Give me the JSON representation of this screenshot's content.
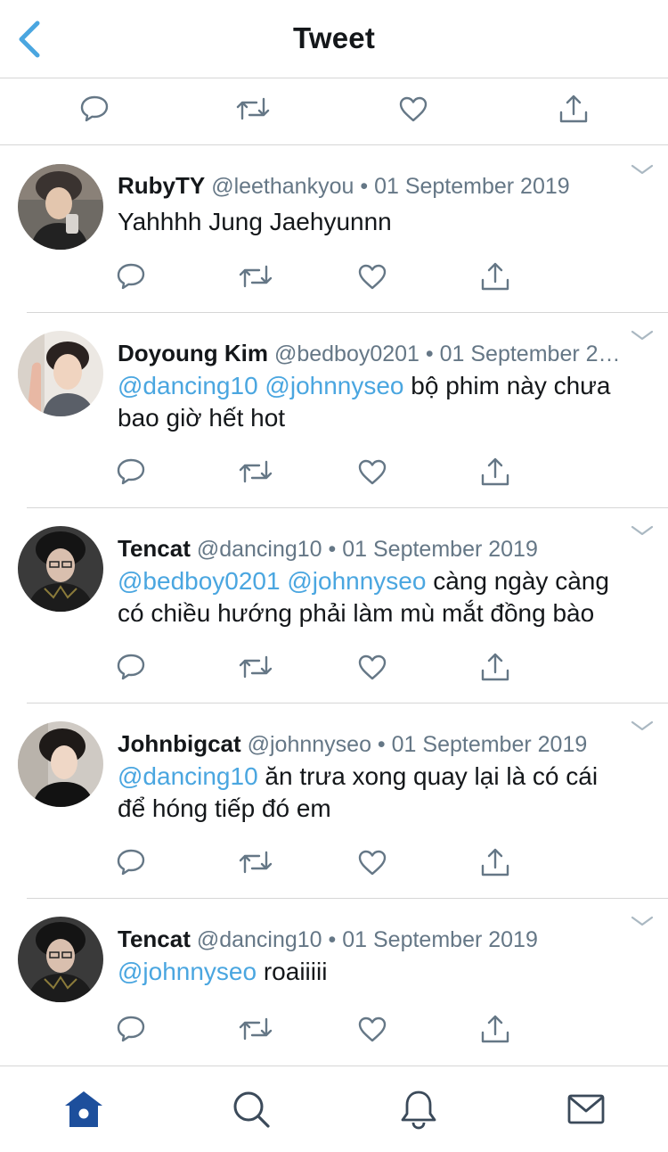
{
  "header": {
    "title": "Tweet",
    "back_icon": "chevron-left-icon",
    "accent": "#4aa6e0"
  },
  "main_actions": [
    "reply-icon",
    "retweet-icon",
    "like-icon",
    "share-icon"
  ],
  "replies": [
    {
      "name": "RubyTY",
      "handle": "@leethankyou",
      "date": "01 September 2019",
      "lines": [
        [
          {
            "t": "Yahhhh Jung Jaehyunnn",
            "m": false
          }
        ]
      ]
    },
    {
      "name": "Doyoung Kim",
      "handle": "@bedboy0201",
      "date": "01 September 2…",
      "lines": [
        [
          {
            "t": "@dancing10 @johnnyseo",
            "m": true
          },
          {
            "t": " bộ phim này chưa",
            "m": false
          }
        ],
        [
          {
            "t": "bao giờ hết hot",
            "m": false
          }
        ]
      ]
    },
    {
      "name": "Tencat",
      "handle": "@dancing10",
      "date": "01 September 2019",
      "lines": [
        [
          {
            "t": "@bedboy0201 @johnnyseo",
            "m": true
          },
          {
            "t": " càng ngày càng",
            "m": false
          }
        ],
        [
          {
            "t": "có chiều hướng phải làm mù mắt đồng bào",
            "m": false
          }
        ]
      ]
    },
    {
      "name": "Johnbigcat",
      "handle": "@johnnyseo",
      "date": "01 September 2019",
      "lines": [
        [
          {
            "t": "@dancing10",
            "m": true
          },
          {
            "t": " ăn trưa xong quay lại là có cái",
            "m": false
          }
        ],
        [
          {
            "t": "để hóng tiếp đó em",
            "m": false
          }
        ]
      ]
    },
    {
      "name": "Tencat",
      "handle": "@dancing10",
      "date": "01 September 2019",
      "lines": [
        [
          {
            "t": "@johnnyseo",
            "m": true
          },
          {
            "t": " roaiiiii",
            "m": false
          }
        ]
      ]
    }
  ],
  "separator": " • ",
  "tabbar": [
    "home-icon",
    "search-icon",
    "notifications-bell-icon",
    "messages-envelope-icon"
  ],
  "colors": {
    "mention": "#4aa6e0",
    "icon": "#657786",
    "tab_active": "#1d4f9c",
    "tab_inactive": "#3b4a5a"
  }
}
